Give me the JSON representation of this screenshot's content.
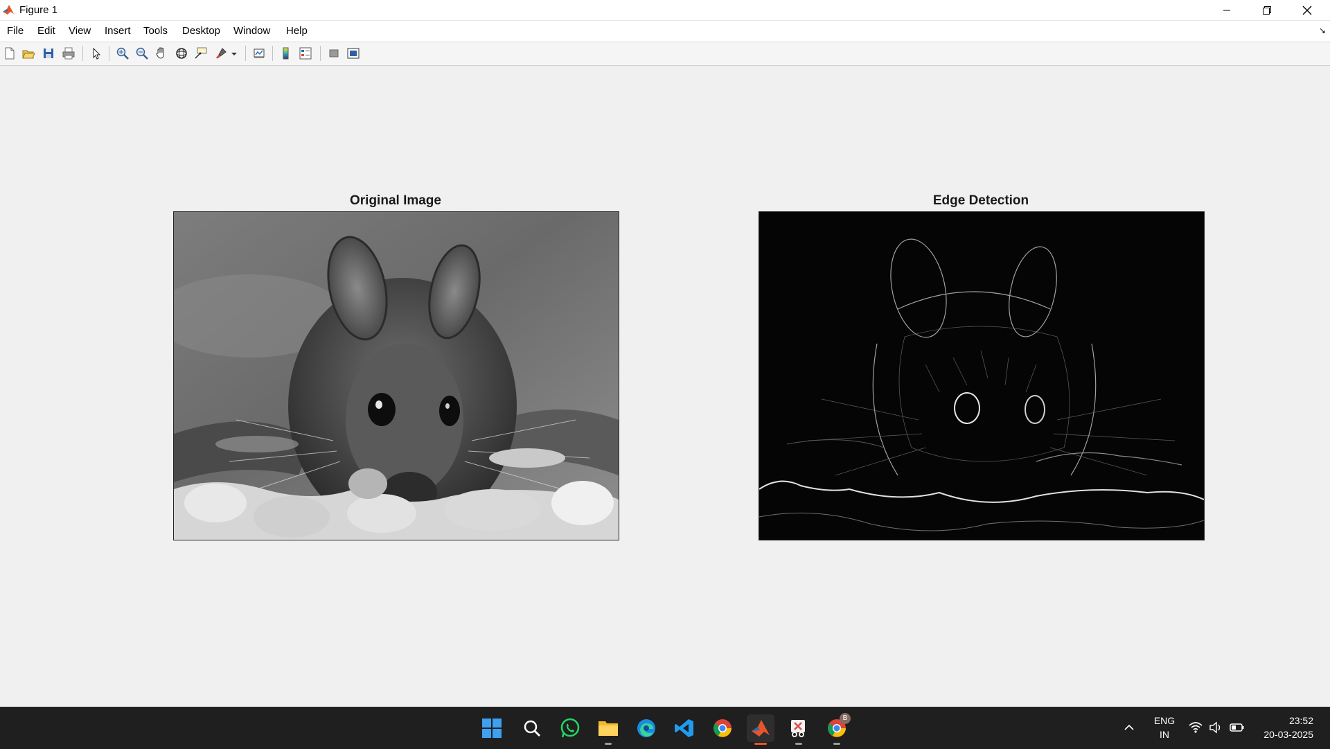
{
  "window": {
    "title": "Figure 1"
  },
  "menu": [
    "File",
    "Edit",
    "View",
    "Insert",
    "Tools",
    "Desktop",
    "Window",
    "Help"
  ],
  "toolbar": {
    "icons": [
      "new-figure-icon",
      "open-file-icon",
      "save-icon",
      "print-icon",
      "edit-plot-pointer-icon",
      "zoom-in-icon",
      "zoom-out-icon",
      "pan-hand-icon",
      "rotate-3d-icon",
      "data-cursor-icon",
      "brush-icon",
      "brush-dropdown-icon",
      "link-plot-icon",
      "colorbar-icon",
      "legend-icon",
      "hide-plot-tools-icon",
      "show-plot-tools-icon"
    ]
  },
  "figure": {
    "left_title": "Original Image",
    "right_title": "Edge Detection"
  },
  "taskbar": {
    "apps": [
      "start-menu-icon",
      "search-icon",
      "whatsapp-icon",
      "file-explorer-icon",
      "edge-browser-icon",
      "vscode-icon",
      "chrome-icon",
      "matlab-icon",
      "snipping-tool-icon",
      "chrome-profile-icon"
    ],
    "chrome_profile_badge": "B",
    "language_top": "ENG",
    "language_bottom": "IN",
    "time": "23:52",
    "date": "20-03-2025"
  },
  "colors": {
    "taskbar_bg": "#1f1f1f",
    "canvas_bg": "#f0f0f0",
    "matlab_accent": "#e8552b"
  }
}
